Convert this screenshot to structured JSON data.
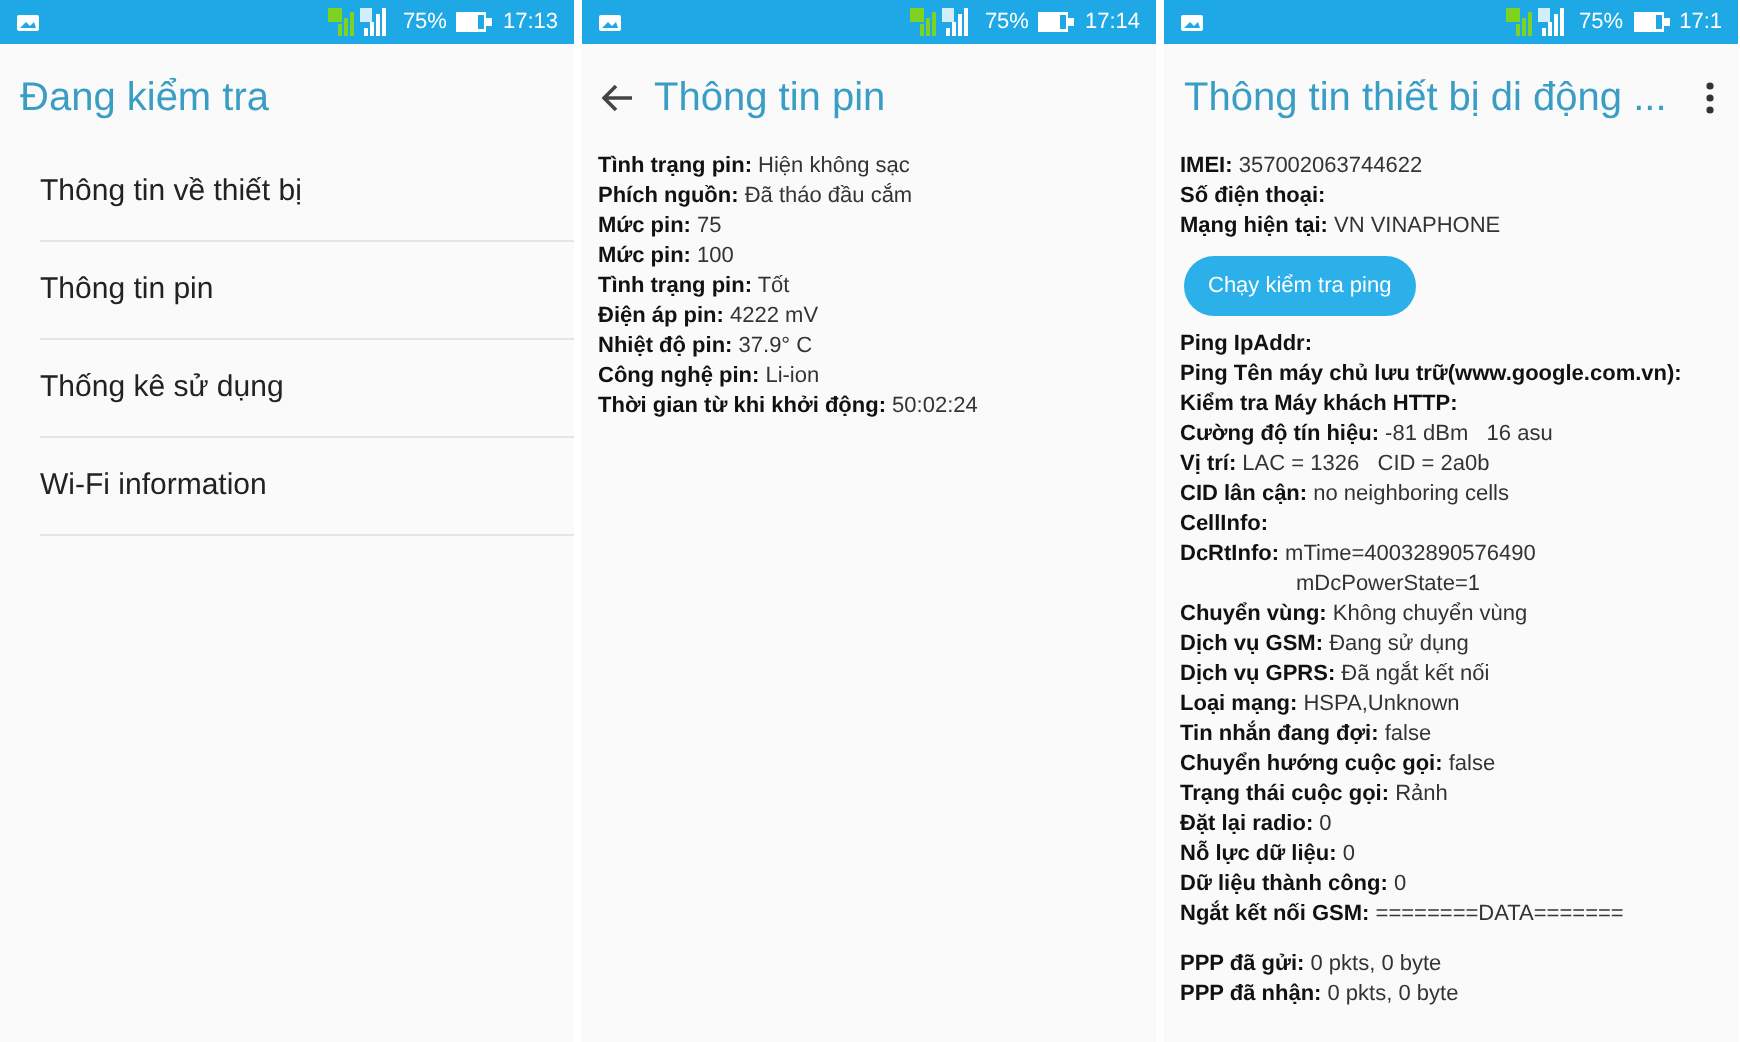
{
  "screens": [
    {
      "kind": "menu",
      "status_bar": {
        "battery": "75%",
        "time": "17:13"
      },
      "title": "Đang kiểm tra",
      "items": [
        {
          "label": "Thông tin về thiết bị"
        },
        {
          "label": "Thông tin pin"
        },
        {
          "label": "Thống kê sử dụng"
        },
        {
          "label": "Wi-Fi information"
        }
      ]
    },
    {
      "kind": "info",
      "status_bar": {
        "battery": "75%",
        "time": "17:14"
      },
      "title": "Thông tin pin",
      "back_button": true,
      "fields": [
        {
          "label": "Tình trạng pin:",
          "value": "Hiện không sạc"
        },
        {
          "label": "Phích nguồn:",
          "value": "Đã tháo đầu cắm"
        },
        {
          "label": "Mức pin:",
          "value": "75"
        },
        {
          "label": "Mức pin:",
          "value": "100"
        },
        {
          "label": "Tình trạng pin:",
          "value": "Tốt"
        },
        {
          "label": "Điện áp pin:",
          "value": "4222 mV"
        },
        {
          "label": "Nhiệt độ pin:",
          "value": "37.9° C"
        },
        {
          "label": "Công nghệ pin:",
          "value": "Li-ion"
        },
        {
          "label": "Thời gian từ khi khởi động:",
          "value": "50:02:24"
        }
      ]
    },
    {
      "kind": "info",
      "status_bar": {
        "battery": "75%",
        "time": "17:1"
      },
      "title": "Thông tin thiết bị di động ...",
      "overflow_menu": true,
      "fields": [
        {
          "label": "IMEI:",
          "value": "357002063744622"
        },
        {
          "label": "Số điện thoại:"
        },
        {
          "label": "Mạng hiện tại:",
          "value": "VN VINAPHONE"
        }
      ],
      "ping_button": "Chạy kiểm tra ping",
      "fields_after_button": [
        {
          "label": "Ping IpAddr:"
        },
        {
          "label": "Ping Tên máy chủ lưu trữ(www.google.com.vn):"
        },
        {
          "label": "Kiểm tra Máy khách HTTP:"
        },
        {
          "label": "Cường độ tín hiệu:",
          "value": "-81 dBm   16 asu"
        },
        {
          "label": "Vị trí:",
          "value": "LAC = 1326   CID = 2a0b"
        },
        {
          "label": "CID lân cận:",
          "value": "no neighboring cells"
        },
        {
          "label": "CellInfo:"
        },
        {
          "label": "DcRtInfo:",
          "value": "mTime=40032890576490",
          "continuation": "mDcPowerState=1"
        },
        {
          "label": "Chuyển vùng:",
          "value": "Không chuyển vùng"
        },
        {
          "label": "Dịch vụ GSM:",
          "value": "Đang sử dụng"
        },
        {
          "label": "Dịch vụ GPRS:",
          "value": "Đã ngắt kết nối"
        },
        {
          "label": "Loại mạng:",
          "value": "HSPA,Unknown"
        },
        {
          "label": "Tin nhắn đang đợi:",
          "value": "false"
        },
        {
          "label": "Chuyển hướng cuộc gọi:",
          "value": "false"
        },
        {
          "label": "Trạng thái cuộc gọi:",
          "value": "Rảnh"
        },
        {
          "label": "Đặt lại radio:",
          "value": "0"
        },
        {
          "label": "Nỗ lực dữ liệu:",
          "value": "0"
        },
        {
          "label": "Dữ liệu thành công:",
          "value": "0"
        },
        {
          "label": "Ngắt kết nối GSM:",
          "value": "========DATA======="
        }
      ],
      "fields_bottom": [
        {
          "label": "PPP đã gửi:",
          "value": "0 pkts, 0 byte"
        },
        {
          "label": "PPP đã nhận:",
          "value": "0 pkts, 0 byte"
        }
      ]
    }
  ]
}
